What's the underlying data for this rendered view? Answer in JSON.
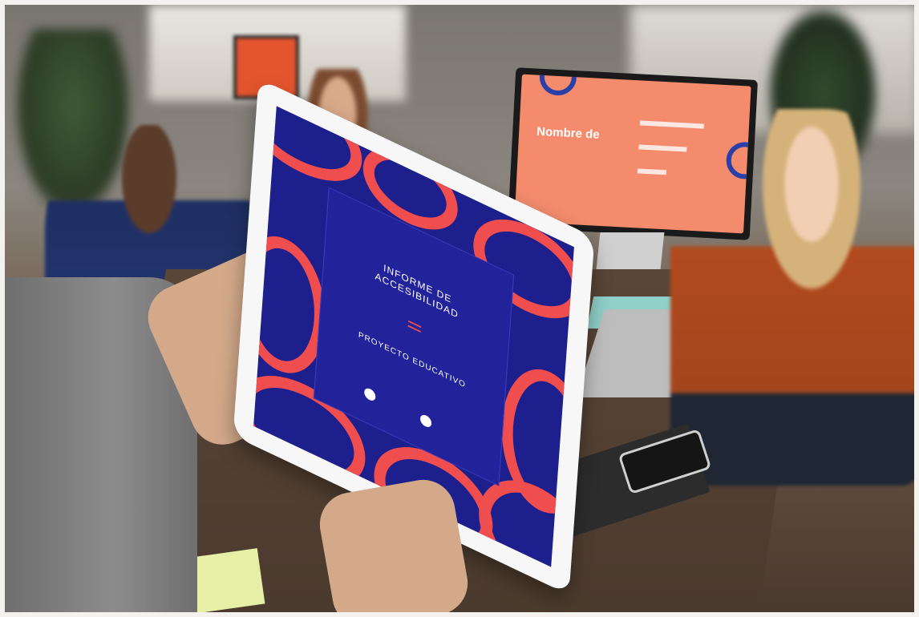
{
  "tablet_cover": {
    "title_line1": "INFORME DE",
    "title_line2": "ACCESIBILIDAD",
    "subtitle": "PROYECTO EDUCATIVO"
  },
  "monitor_screen": {
    "title": "Nombre de",
    "line1": "",
    "line2": "",
    "line3": ""
  },
  "colors": {
    "tablet_blue": "#1c1f8c",
    "tablet_red": "#f04e4e",
    "monitor_salmon": "#f38b6c",
    "table_brown": "#4a3a2d"
  }
}
